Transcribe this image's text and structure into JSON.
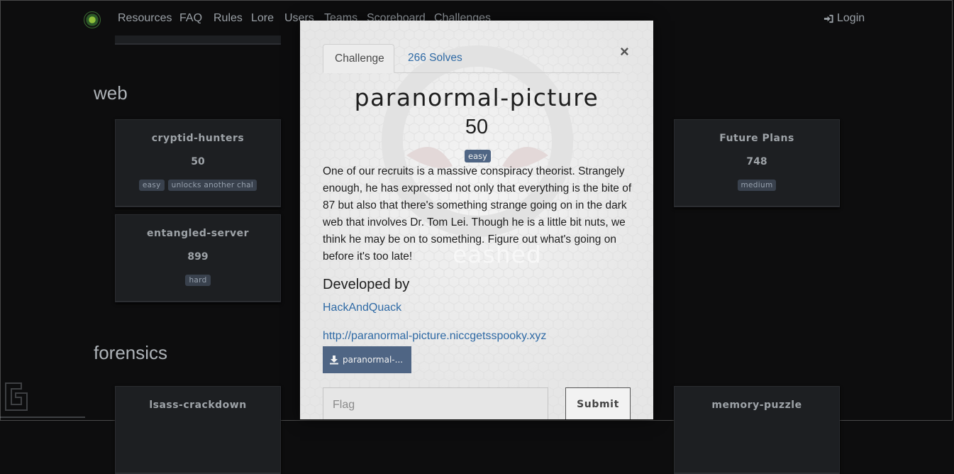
{
  "navbar": {
    "items": [
      "Resources",
      "FAQ",
      "Rules",
      "Lore",
      "Users",
      "Teams",
      "Scoreboard",
      "Challenges"
    ],
    "login_label": "Login"
  },
  "backdrop": {
    "sections": [
      {
        "title": "web",
        "cards": [
          {
            "name": "cryptid-hunters",
            "value": "50",
            "tags": [
              "easy",
              "unlocks another chal"
            ]
          },
          {
            "name": "Future Plans",
            "value": "748",
            "tags": [
              "medium"
            ]
          },
          {
            "name": "entangled-server",
            "value": "899",
            "tags": [
              "hard"
            ]
          }
        ]
      },
      {
        "title": "forensics",
        "cards": [
          {
            "name": "lsass-crackdown"
          },
          {
            "name": "memory-puzzle"
          }
        ]
      }
    ]
  },
  "modal": {
    "tabs": {
      "challenge": "Challenge",
      "solves": "266 Solves"
    },
    "close_symbol": "×",
    "name": "paranormal-picture",
    "value": "50",
    "tag": "easy",
    "description": "One of our recruits is a massive conspiracy theorist. Strangely enough, he has expressed not only that everything is the bite of 87 but also that there's something strange going on in the dark web that involves Dr. Tom Lei. Though he is a little bit nuts, we think he may be on to something. Figure out what's going on before it's too late!",
    "watermark_text": "eashed",
    "developed_by_heading": "Developed by",
    "author": "HackAndQuack",
    "connection_url": "http://paranormal-picture.niccgetsspooky.xyz",
    "file_label": "paranormal-...",
    "flag_placeholder": "Flag",
    "submit_label": "Submit"
  },
  "colors": {
    "accent_blue": "#2f6aa5",
    "badge_slate": "#4f6584",
    "page_background": "#0d0d0e",
    "card_background": "#1d1f22"
  },
  "icons": [
    "site-logo-icon",
    "sign-in-icon",
    "download-icon"
  ]
}
